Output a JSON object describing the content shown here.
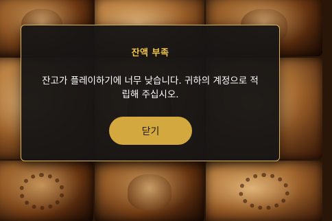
{
  "dialog": {
    "title": "잔액 부족",
    "message": "잔고가 플레이하기에 너무 낮습니다. 귀하의 계정으로 적립해 주십시오.",
    "close_label": "닫기"
  },
  "colors": {
    "title": "#f0c44a",
    "button": "#d3a93f",
    "border": "#d8b255",
    "dialog_bg": "#181615"
  }
}
